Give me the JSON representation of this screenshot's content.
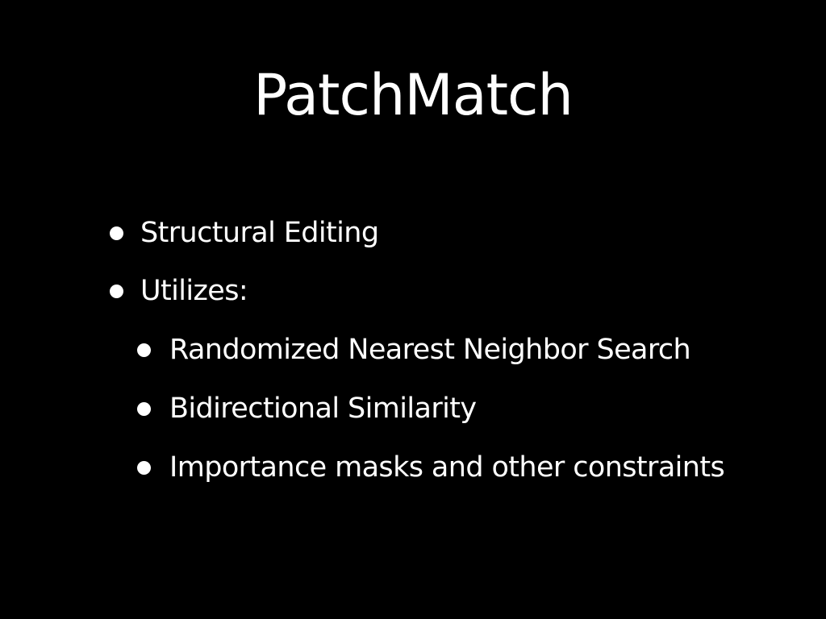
{
  "slide": {
    "title": "PatchMatch",
    "background_color": "#000000",
    "text_color": "#ffffff",
    "bullets": [
      {
        "level": 1,
        "text": "Structural Editing"
      },
      {
        "level": 1,
        "text": "Utilizes:"
      },
      {
        "level": 2,
        "text": "Randomized Nearest Neighbor Search"
      },
      {
        "level": 2,
        "text": "Bidirectional Similarity"
      },
      {
        "level": 2,
        "text": "Importance masks and other constraints"
      }
    ]
  }
}
